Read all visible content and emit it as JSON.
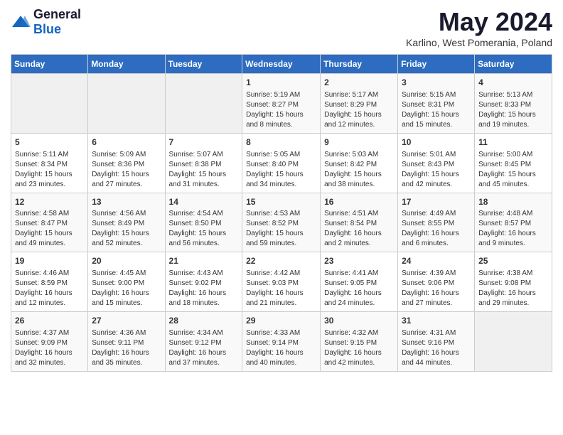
{
  "header": {
    "logo_general": "General",
    "logo_blue": "Blue",
    "title": "May 2024",
    "subtitle": "Karlino, West Pomerania, Poland"
  },
  "weekdays": [
    "Sunday",
    "Monday",
    "Tuesday",
    "Wednesday",
    "Thursday",
    "Friday",
    "Saturday"
  ],
  "weeks": [
    [
      {
        "day": "",
        "sunrise": "",
        "sunset": "",
        "daylight": ""
      },
      {
        "day": "",
        "sunrise": "",
        "sunset": "",
        "daylight": ""
      },
      {
        "day": "",
        "sunrise": "",
        "sunset": "",
        "daylight": ""
      },
      {
        "day": "1",
        "sunrise": "5:19 AM",
        "sunset": "8:27 PM",
        "daylight": "15 hours and 8 minutes."
      },
      {
        "day": "2",
        "sunrise": "5:17 AM",
        "sunset": "8:29 PM",
        "daylight": "15 hours and 12 minutes."
      },
      {
        "day": "3",
        "sunrise": "5:15 AM",
        "sunset": "8:31 PM",
        "daylight": "15 hours and 15 minutes."
      },
      {
        "day": "4",
        "sunrise": "5:13 AM",
        "sunset": "8:33 PM",
        "daylight": "15 hours and 19 minutes."
      }
    ],
    [
      {
        "day": "5",
        "sunrise": "5:11 AM",
        "sunset": "8:34 PM",
        "daylight": "15 hours and 23 minutes."
      },
      {
        "day": "6",
        "sunrise": "5:09 AM",
        "sunset": "8:36 PM",
        "daylight": "15 hours and 27 minutes."
      },
      {
        "day": "7",
        "sunrise": "5:07 AM",
        "sunset": "8:38 PM",
        "daylight": "15 hours and 31 minutes."
      },
      {
        "day": "8",
        "sunrise": "5:05 AM",
        "sunset": "8:40 PM",
        "daylight": "15 hours and 34 minutes."
      },
      {
        "day": "9",
        "sunrise": "5:03 AM",
        "sunset": "8:42 PM",
        "daylight": "15 hours and 38 minutes."
      },
      {
        "day": "10",
        "sunrise": "5:01 AM",
        "sunset": "8:43 PM",
        "daylight": "15 hours and 42 minutes."
      },
      {
        "day": "11",
        "sunrise": "5:00 AM",
        "sunset": "8:45 PM",
        "daylight": "15 hours and 45 minutes."
      }
    ],
    [
      {
        "day": "12",
        "sunrise": "4:58 AM",
        "sunset": "8:47 PM",
        "daylight": "15 hours and 49 minutes."
      },
      {
        "day": "13",
        "sunrise": "4:56 AM",
        "sunset": "8:49 PM",
        "daylight": "15 hours and 52 minutes."
      },
      {
        "day": "14",
        "sunrise": "4:54 AM",
        "sunset": "8:50 PM",
        "daylight": "15 hours and 56 minutes."
      },
      {
        "day": "15",
        "sunrise": "4:53 AM",
        "sunset": "8:52 PM",
        "daylight": "15 hours and 59 minutes."
      },
      {
        "day": "16",
        "sunrise": "4:51 AM",
        "sunset": "8:54 PM",
        "daylight": "16 hours and 2 minutes."
      },
      {
        "day": "17",
        "sunrise": "4:49 AM",
        "sunset": "8:55 PM",
        "daylight": "16 hours and 6 minutes."
      },
      {
        "day": "18",
        "sunrise": "4:48 AM",
        "sunset": "8:57 PM",
        "daylight": "16 hours and 9 minutes."
      }
    ],
    [
      {
        "day": "19",
        "sunrise": "4:46 AM",
        "sunset": "8:59 PM",
        "daylight": "16 hours and 12 minutes."
      },
      {
        "day": "20",
        "sunrise": "4:45 AM",
        "sunset": "9:00 PM",
        "daylight": "16 hours and 15 minutes."
      },
      {
        "day": "21",
        "sunrise": "4:43 AM",
        "sunset": "9:02 PM",
        "daylight": "16 hours and 18 minutes."
      },
      {
        "day": "22",
        "sunrise": "4:42 AM",
        "sunset": "9:03 PM",
        "daylight": "16 hours and 21 minutes."
      },
      {
        "day": "23",
        "sunrise": "4:41 AM",
        "sunset": "9:05 PM",
        "daylight": "16 hours and 24 minutes."
      },
      {
        "day": "24",
        "sunrise": "4:39 AM",
        "sunset": "9:06 PM",
        "daylight": "16 hours and 27 minutes."
      },
      {
        "day": "25",
        "sunrise": "4:38 AM",
        "sunset": "9:08 PM",
        "daylight": "16 hours and 29 minutes."
      }
    ],
    [
      {
        "day": "26",
        "sunrise": "4:37 AM",
        "sunset": "9:09 PM",
        "daylight": "16 hours and 32 minutes."
      },
      {
        "day": "27",
        "sunrise": "4:36 AM",
        "sunset": "9:11 PM",
        "daylight": "16 hours and 35 minutes."
      },
      {
        "day": "28",
        "sunrise": "4:34 AM",
        "sunset": "9:12 PM",
        "daylight": "16 hours and 37 minutes."
      },
      {
        "day": "29",
        "sunrise": "4:33 AM",
        "sunset": "9:14 PM",
        "daylight": "16 hours and 40 minutes."
      },
      {
        "day": "30",
        "sunrise": "4:32 AM",
        "sunset": "9:15 PM",
        "daylight": "16 hours and 42 minutes."
      },
      {
        "day": "31",
        "sunrise": "4:31 AM",
        "sunset": "9:16 PM",
        "daylight": "16 hours and 44 minutes."
      },
      {
        "day": "",
        "sunrise": "",
        "sunset": "",
        "daylight": ""
      }
    ]
  ]
}
